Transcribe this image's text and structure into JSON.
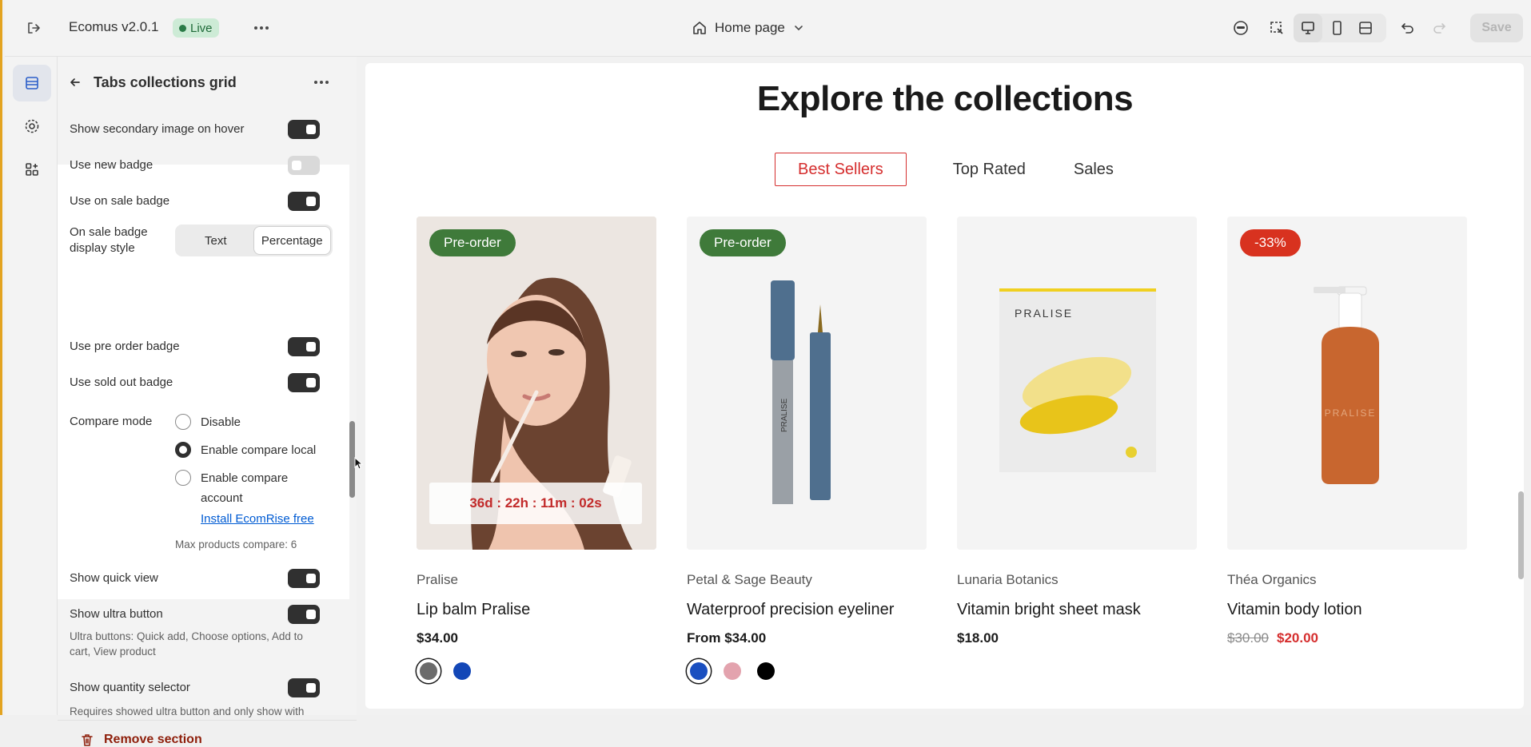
{
  "topbar": {
    "app_name": "Ecomus v2.0.1",
    "status": "Live",
    "page_selector": "Home page",
    "save_label": "Save"
  },
  "panel": {
    "title": "Tabs collections grid",
    "settings": {
      "secondary_image": "Show secondary image on hover",
      "new_badge": "Use new badge",
      "sale_badge": "Use on sale badge",
      "sale_style_label": "On sale badge display style",
      "sale_style_options": [
        "Text",
        "Percentage"
      ],
      "sale_style_selected": "Percentage",
      "preorder_badge": "Use pre order badge",
      "soldout_badge": "Use sold out badge",
      "compare_mode": "Compare mode",
      "compare_options": [
        "Disable",
        "Enable compare local",
        "Enable compare account"
      ],
      "compare_selected": "Enable compare local",
      "install_link": "Install EcomRise free",
      "max_compare": "Max products compare: 6",
      "quick_view": "Show quick view",
      "ultra_button": "Show ultra button",
      "ultra_help": "Ultra buttons: Quick add, Choose options, Add to cart, View product",
      "quantity_selector": "Show quantity selector",
      "quantity_help": "Requires showed ultra button and only show with"
    },
    "toggles": {
      "secondary_image": true,
      "new_badge": false,
      "sale_badge": true,
      "preorder_badge": true,
      "soldout_badge": true,
      "quick_view": true,
      "ultra_button": true,
      "quantity_selector": true
    },
    "remove_label": "Remove section"
  },
  "preview": {
    "heading": "Explore the collections",
    "tabs": [
      "Best Sellers",
      "Top Rated",
      "Sales"
    ],
    "selected_tab": "Best Sellers",
    "products": [
      {
        "badge": "Pre-order",
        "badge_color": "#3f7a3a",
        "countdown": "36d : 22h : 11m : 02s",
        "vendor": "Pralise",
        "name": "Lip balm Pralise",
        "price": "$34.00",
        "swatches": [
          "#6b6b6b",
          "#1347b7"
        ]
      },
      {
        "badge": "Pre-order",
        "badge_color": "#3f7a3a",
        "vendor": "Petal & Sage Beauty",
        "name": "Waterproof precision eyeliner",
        "price": "From $34.00",
        "swatches": [
          "#1a4fc0",
          "#e3a3ae",
          "#000000"
        ]
      },
      {
        "vendor": "Lunaria Botanics",
        "name": "Vitamin bright sheet mask",
        "price": "$18.00",
        "swatches": []
      },
      {
        "badge": "-33%",
        "badge_color": "#d8321f",
        "vendor": "Théa Organics",
        "name": "Vitamin body lotion",
        "old_price": "$30.00",
        "price": "$20.00",
        "swatches": []
      }
    ],
    "product_images": {
      "card3_brand": "PRALISE",
      "card4_brand": "PRALISE",
      "card2_brand": "PRALISE"
    }
  }
}
